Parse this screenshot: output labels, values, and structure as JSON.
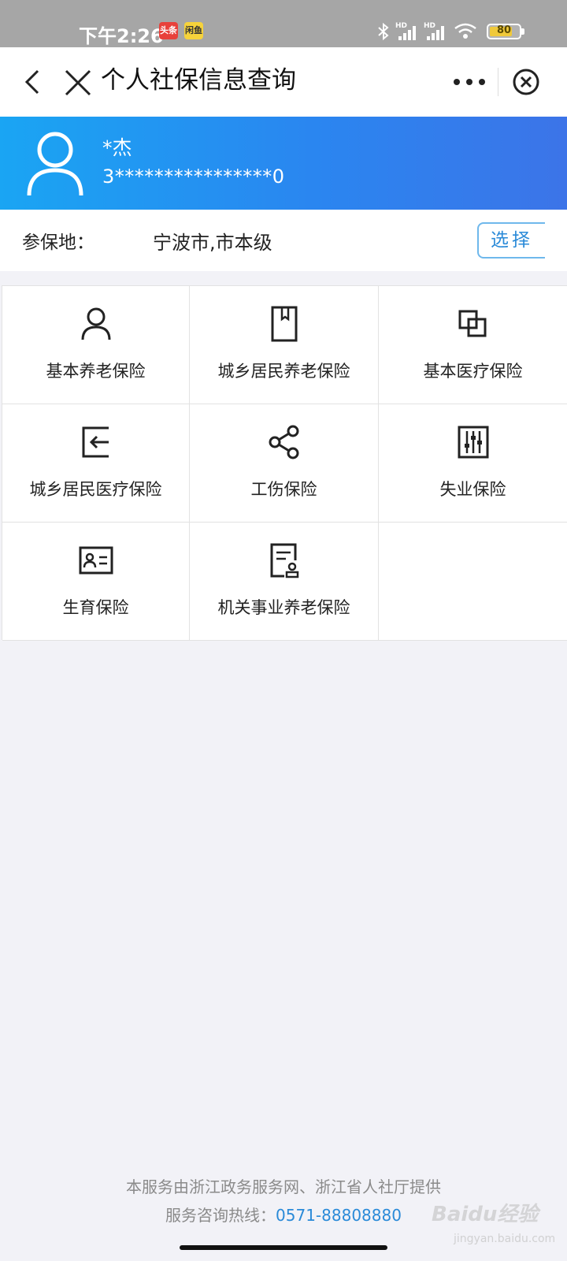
{
  "status_bar": {
    "time": "下午2:26",
    "badge_news": "头条",
    "badge_app": "闲鱼",
    "battery_level": 80,
    "battery_text": "80",
    "network_label": "HD"
  },
  "nav": {
    "title": "个人社保信息查询",
    "back_icon": "chevron-left-icon",
    "close_icon": "close-icon",
    "more_icon": "more-dots-icon",
    "exit_icon": "circle-close-icon"
  },
  "user": {
    "name": "*杰",
    "id_number": "3****************0"
  },
  "location": {
    "label": "参保地：",
    "value": "宁波市,市本级",
    "select_label": "选择"
  },
  "services": [
    {
      "label": "基本养老保险",
      "icon": "person-icon"
    },
    {
      "label": "城乡居民养老保险",
      "icon": "bookmark-book-icon"
    },
    {
      "label": "基本医疗保险",
      "icon": "overlap-squares-icon"
    },
    {
      "label": "城乡居民医疗保险",
      "icon": "sign-in-icon"
    },
    {
      "label": "工伤保险",
      "icon": "share-icon"
    },
    {
      "label": "失业保险",
      "icon": "sliders-icon"
    },
    {
      "label": "生育保险",
      "icon": "id-card-icon"
    },
    {
      "label": "机关事业养老保险",
      "icon": "document-person-icon"
    }
  ],
  "footer": {
    "provider": "本服务由浙江政务服务网、浙江省人社厅提供",
    "hotline_label": "服务咨询热线：",
    "hotline_number": "0571-88808880"
  },
  "watermark": {
    "brand": "Baidu经验",
    "url": "jingyan.baidu.com"
  },
  "colors": {
    "banner_start": "#1aa5f3",
    "banner_end": "#3c74e8",
    "accent": "#2a8ad8",
    "background": "#f2f2f7"
  }
}
